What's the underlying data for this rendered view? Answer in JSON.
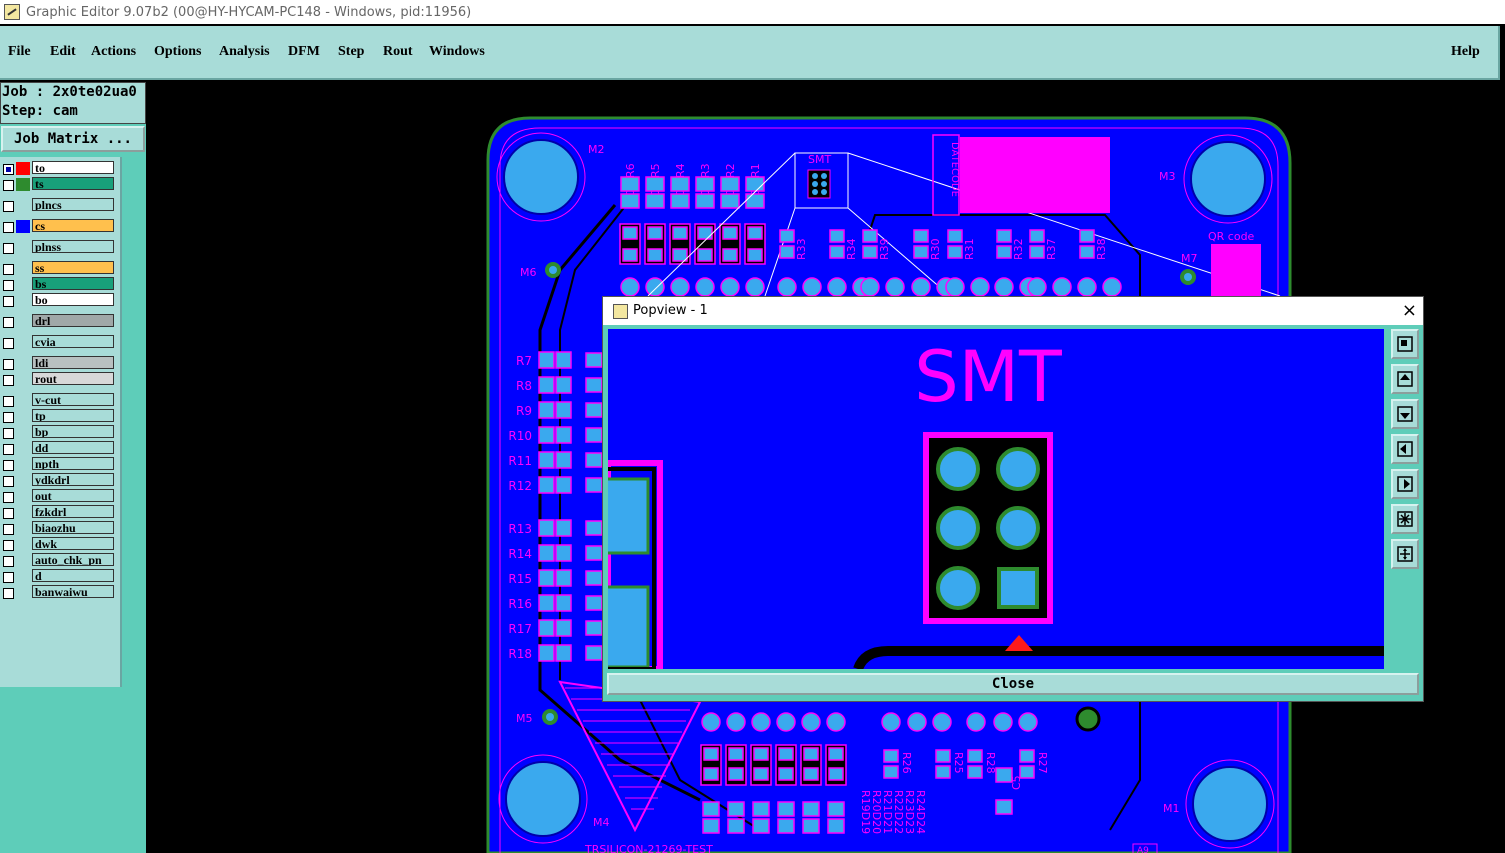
{
  "window": {
    "title": "Graphic Editor 9.07b2 (00@HY-HYCAM-PC148 - Windows, pid:11956)"
  },
  "menu": {
    "file": "File",
    "edit": "Edit",
    "actions": "Actions",
    "options": "Options",
    "analysis": "Analysis",
    "dfm": "DFM",
    "step": "Step",
    "rout": "Rout",
    "windows": "Windows",
    "help": "Help"
  },
  "job": {
    "job_line": "Job : 2x0te02ua0",
    "step_line": "Step: cam",
    "matrix_button": "Job Matrix ..."
  },
  "layers": [
    {
      "name": "to",
      "color": "#ff0000",
      "bg": "#ffffff"
    },
    {
      "name": "ts",
      "color": "#2e8b2e",
      "bg": "#18a07a"
    },
    {
      "name": "plncs",
      "color": "",
      "bg": "#a8dcd8"
    },
    {
      "name": "cs",
      "color": "#0000ff",
      "bg": "#ffc04d"
    },
    {
      "name": "plnss",
      "color": "",
      "bg": "#a8dcd8"
    },
    {
      "name": "ss",
      "color": "",
      "bg": "#ffc04d"
    },
    {
      "name": "bs",
      "color": "",
      "bg": "#18a07a"
    },
    {
      "name": "bo",
      "color": "",
      "bg": "#ffffff"
    },
    {
      "name": "drl",
      "color": "",
      "bg": "#a0a8a8"
    },
    {
      "name": "cvia",
      "color": "",
      "bg": "#a8dcd8"
    },
    {
      "name": "ldi",
      "color": "",
      "bg": "#b8c0c0"
    },
    {
      "name": "rout",
      "color": "",
      "bg": "#d8d8d8"
    },
    {
      "name": "v-cut",
      "color": "",
      "bg": "#a8dcd8"
    },
    {
      "name": "tp",
      "color": "",
      "bg": "#a8dcd8"
    },
    {
      "name": "bp",
      "color": "",
      "bg": "#a8dcd8"
    },
    {
      "name": "dd",
      "color": "",
      "bg": "#a8dcd8"
    },
    {
      "name": "npth",
      "color": "",
      "bg": "#a8dcd8"
    },
    {
      "name": "ydkdrl",
      "color": "",
      "bg": "#a8dcd8"
    },
    {
      "name": "out",
      "color": "",
      "bg": "#a8dcd8"
    },
    {
      "name": "fzkdrl",
      "color": "",
      "bg": "#a8dcd8"
    },
    {
      "name": "biaozhu",
      "color": "",
      "bg": "#a8dcd8"
    },
    {
      "name": "dwk",
      "color": "",
      "bg": "#a8dcd8"
    },
    {
      "name": "auto_chk_pn",
      "color": "",
      "bg": "#a8dcd8"
    },
    {
      "name": "d",
      "color": "",
      "bg": "#a8dcd8"
    },
    {
      "name": "banwaiwu",
      "color": "",
      "bg": "#a8dcd8"
    }
  ],
  "board": {
    "mounts": [
      "M2",
      "M3",
      "M6",
      "M7",
      "M5",
      "M4",
      "M1"
    ],
    "top_labels": [
      "D6 R6",
      "D5 R5",
      "D4 R4",
      "D3 R3",
      "D2 R2",
      "D1 R1"
    ],
    "smt_label": "SMT",
    "top_res": [
      "R33",
      "R34",
      "R39",
      "R30",
      "R31",
      "R32",
      "R37",
      "R38"
    ],
    "left_res": [
      "R7",
      "R8",
      "R9",
      "R10",
      "R11",
      "R12",
      "R13",
      "R14",
      "R15",
      "R16",
      "R17",
      "R18"
    ],
    "qr_label": "QR code",
    "bottom_labels": [
      "R19D19",
      "R20D20",
      "R21D21",
      "R22D22",
      "R23D23",
      "R24D24"
    ],
    "bottom_res": [
      "R26",
      "R25",
      "R28",
      "R27"
    ],
    "c5": "C5",
    "bottom_text": "TRSILICON-21269-TEST",
    "a9": "A9"
  },
  "popview": {
    "title": "Popview - 1",
    "close_x": "×",
    "smt_text": "SMT",
    "close_button": "Close"
  },
  "colors": {
    "board": "#0000ff",
    "pad": "#3aa9ee",
    "silk": "#ff00ff",
    "panel": "#a8dcd8",
    "panel_dark": "#5ecdb9",
    "copper_outline": "#2e8b2e"
  }
}
